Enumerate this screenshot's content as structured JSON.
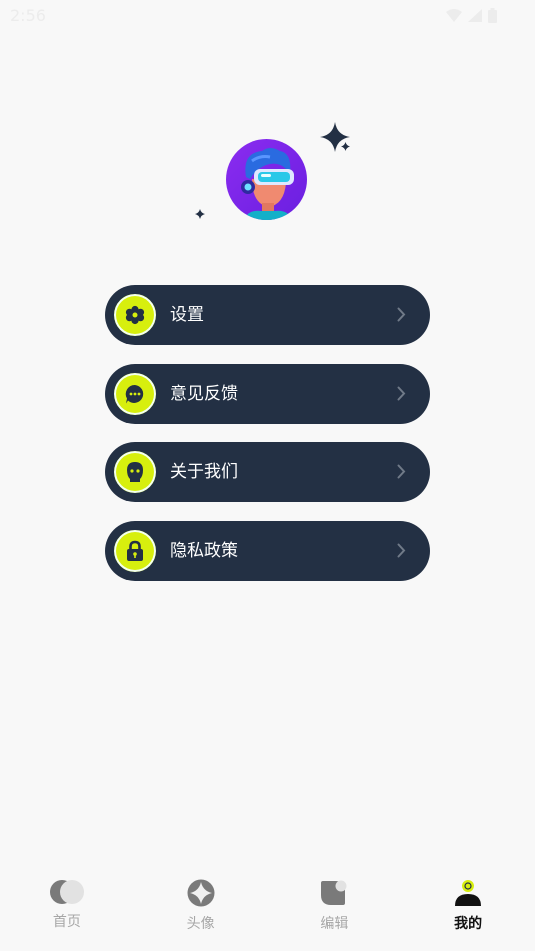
{
  "status_bar": {
    "time": "2:56",
    "icons": [
      "wifi-icon",
      "signal-icon",
      "battery-icon"
    ]
  },
  "profile": {
    "avatar": "avatar-vr-boy"
  },
  "menu": {
    "items": [
      {
        "label": "设置",
        "icon": "gear-icon"
      },
      {
        "label": "意见反馈",
        "icon": "chat-bubble-icon"
      },
      {
        "label": "关于我们",
        "icon": "ghost-icon"
      },
      {
        "label": "隐私政策",
        "icon": "lock-icon"
      }
    ]
  },
  "tabs": [
    {
      "label": "首页",
      "icon": "home-icon",
      "active": false
    },
    {
      "label": "头像",
      "icon": "avatar-icon",
      "active": false
    },
    {
      "label": "编辑",
      "icon": "edit-icon",
      "active": false
    },
    {
      "label": "我的",
      "icon": "profile-icon",
      "active": true
    }
  ],
  "colors": {
    "background": "#f8f8f8",
    "card": "#233044",
    "accent": "#d7ef0e",
    "tab_inactive": "#a7a7a7",
    "tab_active": "#111111"
  }
}
